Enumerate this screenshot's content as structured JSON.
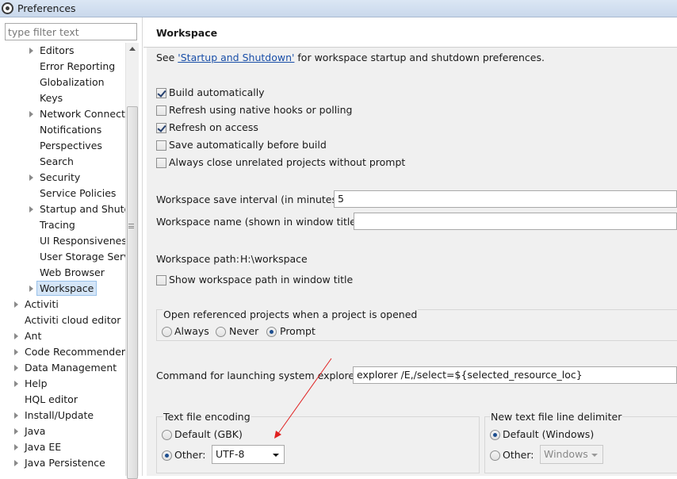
{
  "window": {
    "title": "Preferences"
  },
  "filter": {
    "placeholder": "type filter text"
  },
  "tree": {
    "items": [
      {
        "label": "Editors",
        "expandable": true
      },
      {
        "label": "Error Reporting",
        "expandable": false
      },
      {
        "label": "Globalization",
        "expandable": false
      },
      {
        "label": "Keys",
        "expandable": false
      },
      {
        "label": "Network Connectio",
        "expandable": true
      },
      {
        "label": "Notifications",
        "expandable": false
      },
      {
        "label": "Perspectives",
        "expandable": false
      },
      {
        "label": "Search",
        "expandable": false
      },
      {
        "label": "Security",
        "expandable": true
      },
      {
        "label": "Service Policies",
        "expandable": false
      },
      {
        "label": "Startup and Shutd",
        "expandable": true
      },
      {
        "label": "Tracing",
        "expandable": false
      },
      {
        "label": "UI Responsiveness",
        "expandable": false
      },
      {
        "label": "User Storage Serv",
        "expandable": false
      },
      {
        "label": "Web Browser",
        "expandable": false
      },
      {
        "label": "Workspace",
        "expandable": true,
        "selected": true
      },
      {
        "label": "Activiti",
        "expandable": true,
        "top": true
      },
      {
        "label": "Activiti cloud editor",
        "expandable": false,
        "top": true
      },
      {
        "label": "Ant",
        "expandable": true,
        "top": true
      },
      {
        "label": "Code Recommenders",
        "expandable": true,
        "top": true
      },
      {
        "label": "Data Management",
        "expandable": true,
        "top": true
      },
      {
        "label": "Help",
        "expandable": true,
        "top": true
      },
      {
        "label": "HQL editor",
        "expandable": false,
        "top": true
      },
      {
        "label": "Install/Update",
        "expandable": true,
        "top": true
      },
      {
        "label": "Java",
        "expandable": true,
        "top": true
      },
      {
        "label": "Java EE",
        "expandable": true,
        "top": true
      },
      {
        "label": "Java Persistence",
        "expandable": true,
        "top": true
      }
    ]
  },
  "page": {
    "title": "Workspace",
    "see_prefix": "See ",
    "see_link": "'Startup and Shutdown'",
    "see_suffix": " for workspace startup and shutdown preferences.",
    "checkboxes": {
      "build_auto": {
        "label": "Build automatically",
        "checked": true
      },
      "refresh_native": {
        "label": "Refresh using native hooks or polling",
        "checked": false
      },
      "refresh_access": {
        "label": "Refresh on access",
        "checked": true
      },
      "save_before_build": {
        "label": "Save automatically before build",
        "checked": false
      },
      "close_unrelated": {
        "label": "Always close unrelated projects without prompt",
        "checked": false
      }
    },
    "save_interval": {
      "label": "Workspace save interval (in minutes):",
      "value": "5"
    },
    "workspace_name": {
      "label": "Workspace name (shown in window title):",
      "value": ""
    },
    "workspace_path": {
      "label": "Workspace path:",
      "value": "H:\\workspace"
    },
    "show_path": {
      "label": "Show workspace path in window title",
      "checked": false
    },
    "open_referenced": {
      "label": "Open referenced projects when a project is opened",
      "options": [
        "Always",
        "Never",
        "Prompt"
      ],
      "selected": "Prompt"
    },
    "explorer_cmd": {
      "label": "Command for launching system explorer:",
      "value": "explorer /E,/select=${selected_resource_loc}"
    },
    "encoding": {
      "label": "Text file encoding",
      "default_label": "Default (GBK)",
      "other_label": "Other:",
      "selected": "Other",
      "other_value": "UTF-8"
    },
    "line_delimiter": {
      "label": "New text file line delimiter",
      "default_label": "Default (Windows)",
      "other_label": "Other:",
      "selected": "Default",
      "other_value": "Windows"
    }
  },
  "colors": {
    "annotation_arrow": "#e02020",
    "link": "#1a4fa8",
    "selection": "#d4e5f7"
  }
}
